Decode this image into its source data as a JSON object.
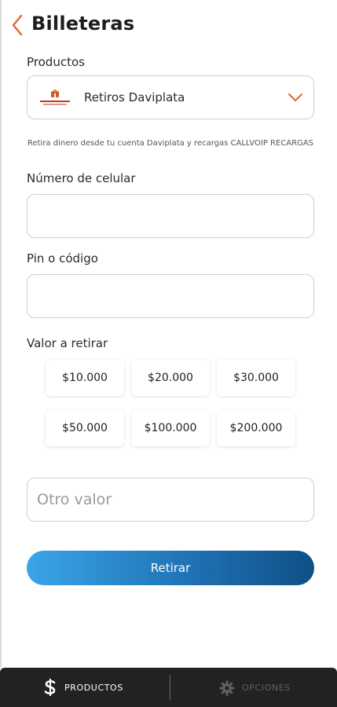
{
  "header": {
    "title": "Billeteras"
  },
  "productos": {
    "label": "Productos",
    "selected": "Retiros Daviplata",
    "description": "Retira dinero desde tu cuenta Daviplata y recargas CALLVOIP RECARGAS"
  },
  "celular": {
    "label": "Número de celular",
    "value": ""
  },
  "pin": {
    "label": "Pin o código",
    "value": ""
  },
  "valor": {
    "label": "Valor a retirar",
    "amounts": [
      "$10.000",
      "$20.000",
      "$30.000",
      "$50.000",
      "$100.000",
      "$200.000"
    ]
  },
  "otro": {
    "placeholder": "Otro valor"
  },
  "submit": {
    "label": "Retirar"
  },
  "bottom_nav": {
    "productos": {
      "label": "PRODUCTOS",
      "icon": "dollar-icon"
    },
    "opciones": {
      "label": "OPCIONES",
      "icon": "gear-icon"
    }
  },
  "colors": {
    "accent_orange": "#e0652f",
    "button_gradient_start": "#3aa5e8",
    "button_gradient_end": "#0f4f86",
    "bottom_bar": "#222222"
  }
}
